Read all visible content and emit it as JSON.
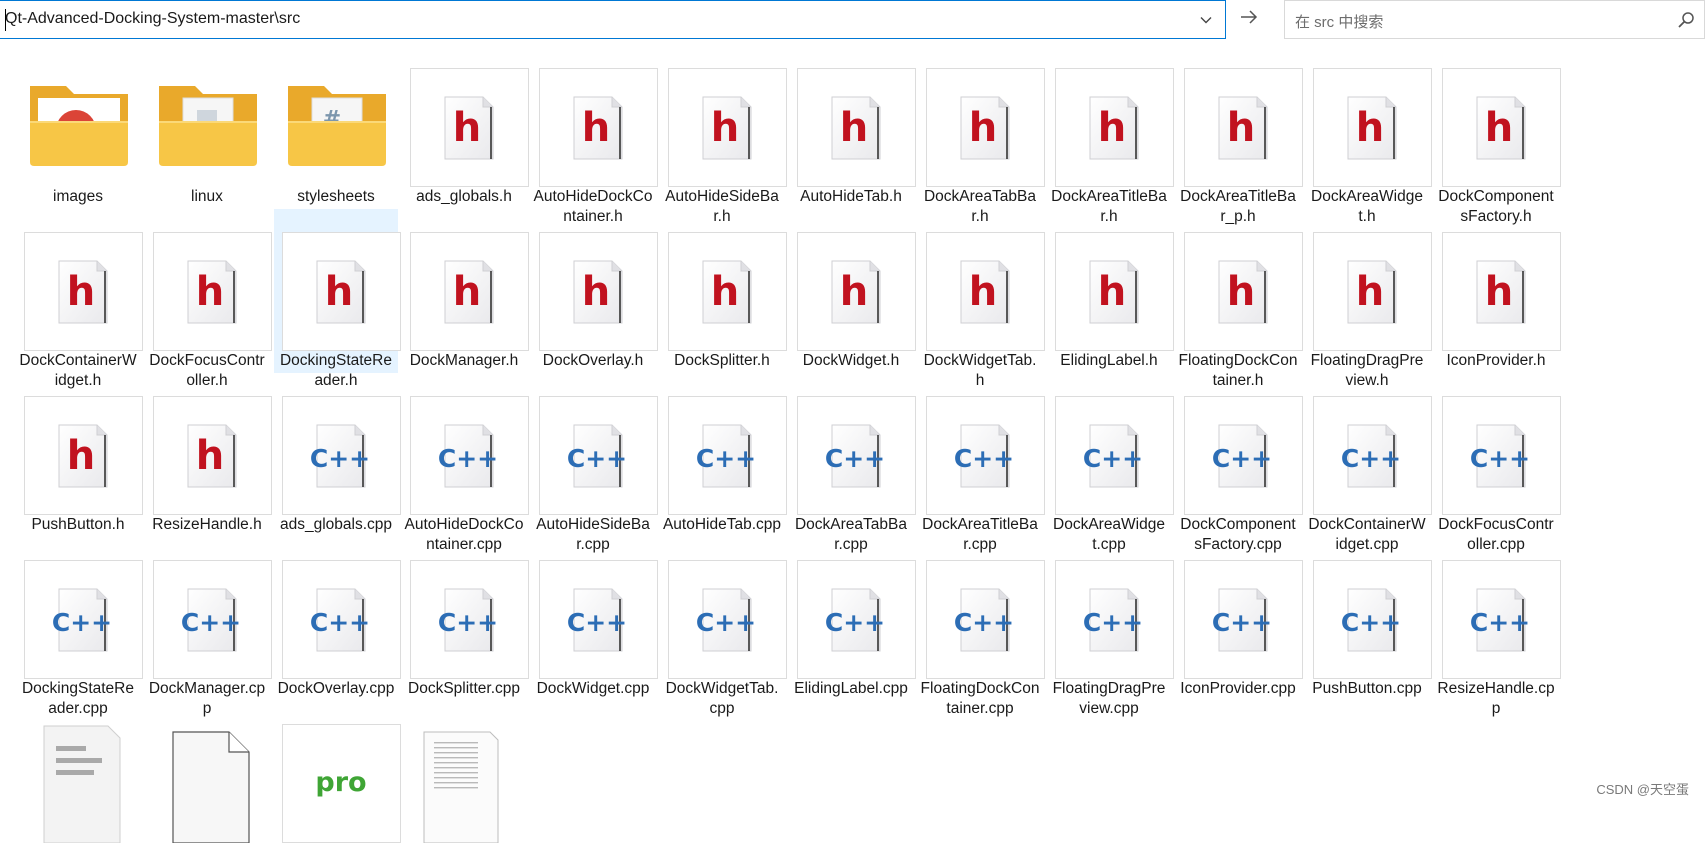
{
  "address": {
    "path": "Qt-Advanced-Docking-System-master\\src"
  },
  "search": {
    "placeholder": "在 src 中搜索"
  },
  "icons": {
    "dropdown": "chevron-down-icon",
    "go": "arrow-right-icon",
    "search": "search-icon"
  },
  "colors": {
    "accent": "#0078d4",
    "selection": "#e5f3ff",
    "folder": "#f5c342",
    "header_h": "#c1121f",
    "cpp_text": "#2c6db5",
    "pro_text": "#3fa535"
  },
  "items": [
    {
      "name": "images",
      "type": "folder-chrome"
    },
    {
      "name": "linux",
      "type": "folder-doc"
    },
    {
      "name": "stylesheets",
      "type": "folder-css"
    },
    {
      "name": "ads_globals.h",
      "type": "h"
    },
    {
      "name": "AutoHideDockContainer.h",
      "type": "h"
    },
    {
      "name": "AutoHideSideBar.h",
      "type": "h"
    },
    {
      "name": "AutoHideTab.h",
      "type": "h"
    },
    {
      "name": "DockAreaTabBar.h",
      "type": "h"
    },
    {
      "name": "DockAreaTitleBar.h",
      "type": "h"
    },
    {
      "name": "DockAreaTitleBar_p.h",
      "type": "h"
    },
    {
      "name": "DockAreaWidget.h",
      "type": "h"
    },
    {
      "name": "DockComponentsFactory.h",
      "type": "h"
    },
    {
      "name": "DockContainerWidget.h",
      "type": "h"
    },
    {
      "name": "DockFocusController.h",
      "type": "h"
    },
    {
      "name": "DockingStateReader.h",
      "type": "h",
      "selected": true
    },
    {
      "name": "DockManager.h",
      "type": "h"
    },
    {
      "name": "DockOverlay.h",
      "type": "h"
    },
    {
      "name": "DockSplitter.h",
      "type": "h"
    },
    {
      "name": "DockWidget.h",
      "type": "h"
    },
    {
      "name": "DockWidgetTab.h",
      "type": "h"
    },
    {
      "name": "ElidingLabel.h",
      "type": "h"
    },
    {
      "name": "FloatingDockContainer.h",
      "type": "h"
    },
    {
      "name": "FloatingDragPreview.h",
      "type": "h"
    },
    {
      "name": "IconProvider.h",
      "type": "h"
    },
    {
      "name": "PushButton.h",
      "type": "h"
    },
    {
      "name": "ResizeHandle.h",
      "type": "h"
    },
    {
      "name": "ads_globals.cpp",
      "type": "cpp"
    },
    {
      "name": "AutoHideDockContainer.cpp",
      "type": "cpp"
    },
    {
      "name": "AutoHideSideBar.cpp",
      "type": "cpp"
    },
    {
      "name": "AutoHideTab.cpp",
      "type": "cpp"
    },
    {
      "name": "DockAreaTabBar.cpp",
      "type": "cpp"
    },
    {
      "name": "DockAreaTitleBar.cpp",
      "type": "cpp"
    },
    {
      "name": "DockAreaWidget.cpp",
      "type": "cpp"
    },
    {
      "name": "DockComponentsFactory.cpp",
      "type": "cpp"
    },
    {
      "name": "DockContainerWidget.cpp",
      "type": "cpp"
    },
    {
      "name": "DockFocusController.cpp",
      "type": "cpp"
    },
    {
      "name": "DockingStateReader.cpp",
      "type": "cpp"
    },
    {
      "name": "DockManager.cpp",
      "type": "cpp"
    },
    {
      "name": "DockOverlay.cpp",
      "type": "cpp"
    },
    {
      "name": "DockSplitter.cpp",
      "type": "cpp"
    },
    {
      "name": "DockWidget.cpp",
      "type": "cpp"
    },
    {
      "name": "DockWidgetTab.cpp",
      "type": "cpp"
    },
    {
      "name": "ElidingLabel.cpp",
      "type": "cpp"
    },
    {
      "name": "FloatingDockContainer.cpp",
      "type": "cpp"
    },
    {
      "name": "FloatingDragPreview.cpp",
      "type": "cpp"
    },
    {
      "name": "IconProvider.cpp",
      "type": "cpp"
    },
    {
      "name": "PushButton.cpp",
      "type": "cpp"
    },
    {
      "name": "ResizeHandle.cpp",
      "type": "cpp"
    },
    {
      "name": "",
      "type": "doc-lines"
    },
    {
      "name": "",
      "type": "blank"
    },
    {
      "name": "",
      "type": "pro",
      "badge": "pro"
    },
    {
      "name": "",
      "type": "text"
    }
  ],
  "watermark": "CSDN @天空蛋"
}
